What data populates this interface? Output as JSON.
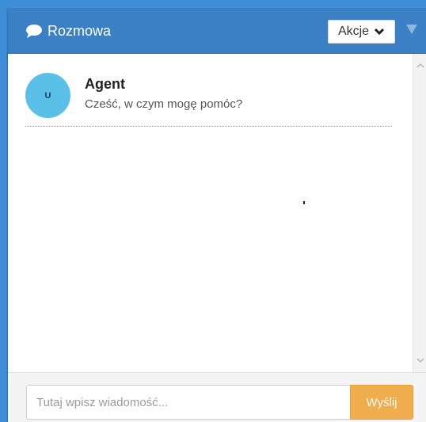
{
  "header": {
    "title": "Rozmowa",
    "title_icon": "chat-bubble-icon",
    "actions_label": "Akcje",
    "actions_icon": "chevron-down-icon",
    "collapse_icon": "triangle-down-icon"
  },
  "messages": [
    {
      "avatar_text": "U",
      "author": "Agent",
      "text": "Cześć, w czym mogę pomóc?"
    }
  ],
  "composer": {
    "placeholder": "Tutaj wpisz wiadomość...",
    "value": "",
    "send_label": "Wyślij"
  },
  "colors": {
    "header_bg": "#3b7fc4",
    "avatar_bg": "#5bc0e8",
    "send_bg": "#f0ad4e",
    "page_bg": "#3e8ed8"
  }
}
